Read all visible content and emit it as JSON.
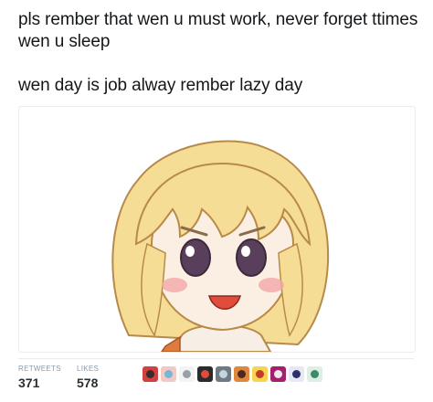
{
  "tweet": {
    "line1": "pls rember that wen u must work, never forget ttimes wen u sleep",
    "line2": "wen day is job alway rember lazy day"
  },
  "stats": {
    "retweets_label": "RETWEETS",
    "retweets_count": "371",
    "likes_label": "LIKES",
    "likes_count": "578"
  },
  "avatars": [
    {
      "bg": "#d0413f",
      "fg": "#3b2a2a"
    },
    {
      "bg": "#f4c9c4",
      "fg": "#7ab6d9"
    },
    {
      "bg": "#f3f3f3",
      "fg": "#9aa0a6"
    },
    {
      "bg": "#2b2b2b",
      "fg": "#e14a3c"
    },
    {
      "bg": "#6e7b86",
      "fg": "#c9d3da"
    },
    {
      "bg": "#e0873c",
      "fg": "#4b2b1d"
    },
    {
      "bg": "#f7d54c",
      "fg": "#c23b2b"
    },
    {
      "bg": "#a3206a",
      "fg": "#f1e6ee"
    },
    {
      "bg": "#e8e8f5",
      "fg": "#2e2f6b"
    },
    {
      "bg": "#dfeee5",
      "fg": "#3a8b6a"
    }
  ]
}
